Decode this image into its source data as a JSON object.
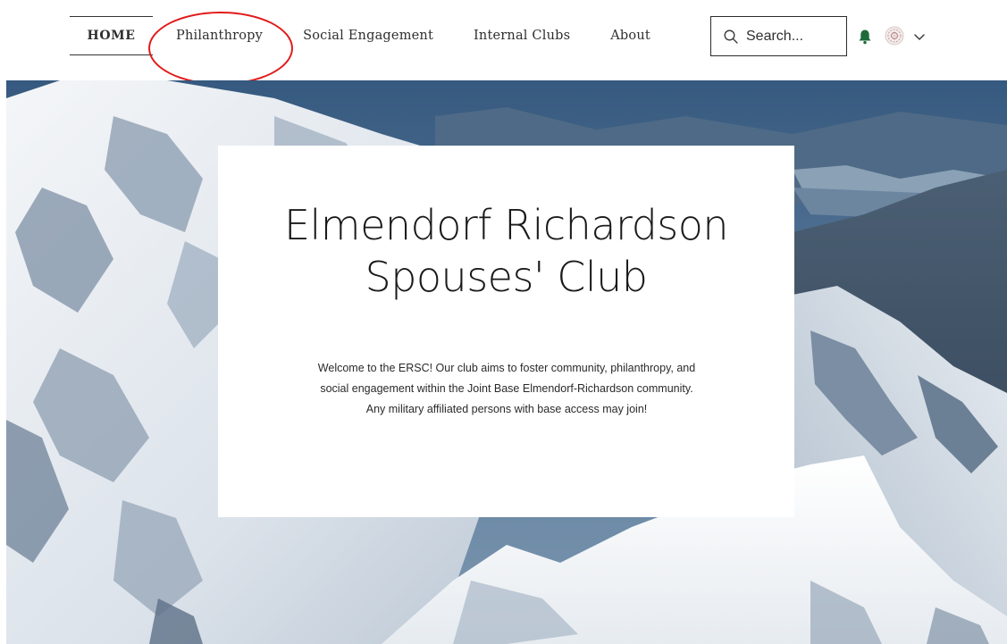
{
  "nav": {
    "items": [
      {
        "label": "HOME"
      },
      {
        "label": "Philanthropy"
      },
      {
        "label": "Social Engagement"
      },
      {
        "label": "Internal Clubs"
      },
      {
        "label": "About"
      }
    ]
  },
  "search": {
    "placeholder": "Search..."
  },
  "colors": {
    "accent_green": "#1f6b3a",
    "annotation_red": "#e21a1a"
  },
  "icons": {
    "search": "search-icon",
    "bell": "bell-icon",
    "avatar": "avatar",
    "chevron": "chevron-down-icon"
  },
  "hero": {
    "title_line1": "Elmendorf Richardson",
    "title_line2": "Spouses' Club",
    "welcome_text": "Welcome to the ERSC! Our club aims to foster community, philanthropy, and social engagement within the  Joint Base Elmendorf-Richardson community. Any military affiliated persons with base access may join!"
  }
}
